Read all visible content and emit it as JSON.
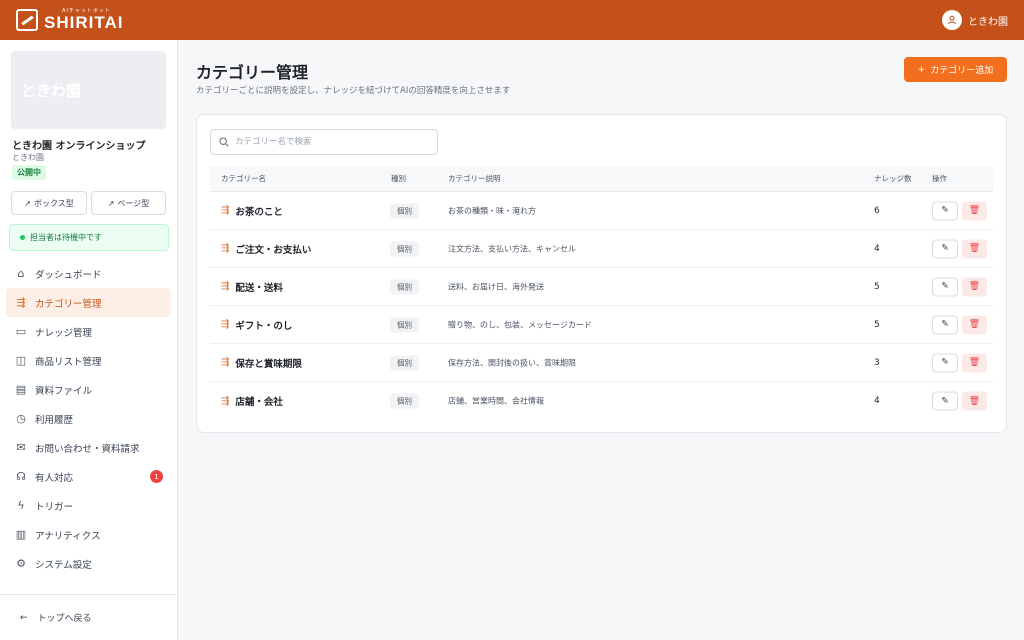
{
  "topbar": {
    "logo_sub": "AIチャットボット",
    "logo_main": "SHIRITAI",
    "user_name": "ときわ園"
  },
  "sidebar": {
    "banner_text": "ときわ園",
    "shop_name": "ときわ園 オンラインショップ",
    "shop_sub": "ときわ園",
    "status": "公開中",
    "box_type": "ボックス型",
    "page_type": "ページ型",
    "agent_status": "担当者は待機中です",
    "items": [
      {
        "label": "ダッシュボード",
        "icon": "home-icon"
      },
      {
        "label": "カテゴリー管理",
        "icon": "category-icon"
      },
      {
        "label": "ナレッジ管理",
        "icon": "book-icon"
      },
      {
        "label": "商品リスト管理",
        "icon": "shopping-bag-icon"
      },
      {
        "label": "資料ファイル",
        "icon": "file-icon"
      },
      {
        "label": "利用履歴",
        "icon": "clock-icon"
      },
      {
        "label": "お問い合わせ・資料請求",
        "icon": "mail-icon"
      },
      {
        "label": "有人対応",
        "icon": "headset-icon",
        "badge": "1"
      },
      {
        "label": "トリガー",
        "icon": "lightning-icon"
      },
      {
        "label": "アナリティクス",
        "icon": "chart-icon"
      },
      {
        "label": "システム設定",
        "icon": "gear-icon"
      }
    ],
    "back_label": "トップへ戻る"
  },
  "main": {
    "title": "カテゴリー管理",
    "subtitle": "カテゴリーごとに説明を設定し、ナレッジを紐づけてAIの回答精度を向上させます",
    "add_label": "カテゴリー追加",
    "search_placeholder": "カテゴリー名で検索",
    "columns": {
      "name": "カテゴリー名",
      "type": "種別",
      "desc": "カテゴリー説明",
      "count": "ナレッジ数",
      "ops": "操作"
    },
    "rows": [
      {
        "name": "お茶のこと",
        "type": "個別",
        "desc": "お茶の種類・味・淹れ方",
        "count": "6"
      },
      {
        "name": "ご注文・お支払い",
        "type": "個別",
        "desc": "注文方法、支払い方法、キャンセル",
        "count": "4"
      },
      {
        "name": "配送・送料",
        "type": "個別",
        "desc": "送料、お届け日、海外発送",
        "count": "5"
      },
      {
        "name": "ギフト・のし",
        "type": "個別",
        "desc": "贈り物、のし、包装、メッセージカード",
        "count": "5"
      },
      {
        "name": "保存と賞味期限",
        "type": "個別",
        "desc": "保存方法、開封後の扱い、賞味期限",
        "count": "3"
      },
      {
        "name": "店舗・会社",
        "type": "個別",
        "desc": "店舗、営業時間、会社情報",
        "count": "4"
      }
    ]
  },
  "colors": {
    "brand": "#c4501a",
    "accent": "#f26f1e",
    "success": "#15803d",
    "danger": "#ef4444"
  }
}
